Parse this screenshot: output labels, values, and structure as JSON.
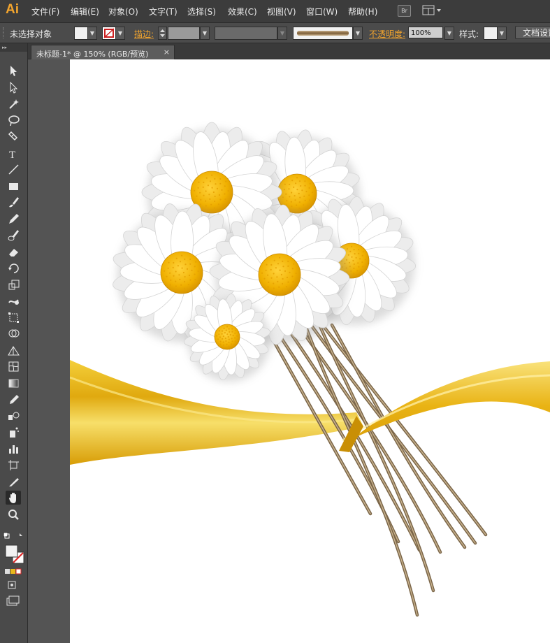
{
  "app": {
    "logo": "Ai"
  },
  "menu": [
    "文件(F)",
    "编辑(E)",
    "对象(O)",
    "文字(T)",
    "选择(S)",
    "效果(C)",
    "视图(V)",
    "窗口(W)",
    "帮助(H)"
  ],
  "bridge_button": "Br",
  "control_bar": {
    "selection_status": "未选择对象",
    "stroke_label": "描边:",
    "opacity_label": "不透明度:",
    "opacity_value": "100%",
    "style_label": "样式:",
    "document_setup_button": "文档设置"
  },
  "document_tab": {
    "title": "未标题-1* @ 150% (RGB/预览)",
    "close_glyph": "×"
  },
  "colors": {
    "accent": "#f3a52e",
    "ribbon_gold": "#e8b81c",
    "daisy_center": "#f2b400",
    "stem": "#8f7a5c"
  },
  "tools": [
    "selection-tool",
    "direct-selection-tool",
    "magic-wand-tool",
    "lasso-tool",
    "pen-tool",
    "type-tool",
    "line-segment-tool",
    "rectangle-tool",
    "paintbrush-tool",
    "pencil-tool",
    "blob-brush-tool",
    "eraser-tool",
    "rotate-tool",
    "scale-tool",
    "warp-tool",
    "free-transform-tool",
    "shape-builder-tool",
    "perspective-grid-tool",
    "mesh-tool",
    "gradient-tool",
    "eyedropper-tool",
    "blend-tool",
    "symbol-sprayer-tool",
    "column-graph-tool",
    "artboard-tool",
    "slice-tool",
    "hand-tool",
    "zoom-tool"
  ],
  "active_tool": "hand-tool"
}
